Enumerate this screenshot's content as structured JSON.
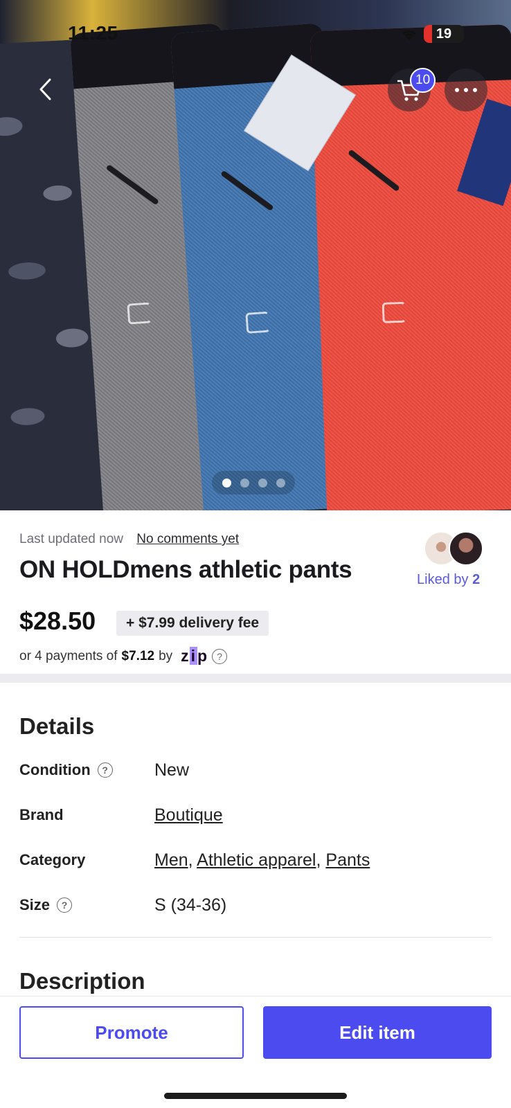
{
  "status_bar": {
    "time": "11:25",
    "battery": "19"
  },
  "header": {
    "cart_count": "10"
  },
  "gallery": {
    "image_count": 4,
    "active_index": 0
  },
  "listing": {
    "last_updated": "Last updated now",
    "comments_link": "No comments yet",
    "title": "ON HOLDmens athletic pants",
    "liked_prefix": "Liked by",
    "liked_count": "2",
    "price": "$28.50",
    "delivery_fee": "+ $7.99 delivery fee",
    "installments_prefix": "or 4 payments of",
    "installment_amount": "$7.12",
    "installments_by": "by",
    "zip_brand": "zip"
  },
  "details": {
    "heading": "Details",
    "condition_label": "Condition",
    "condition_value": "New",
    "brand_label": "Brand",
    "brand_value": "Boutique",
    "category_label": "Category",
    "category_values": [
      "Men",
      "Athletic apparel",
      "Pants"
    ],
    "size_label": "Size",
    "size_value": "S (34-36)"
  },
  "description": {
    "heading": "Description"
  },
  "actions": {
    "promote": "Promote",
    "edit": "Edit item"
  },
  "colors": {
    "accent": "#4b4bf0",
    "liked": "#5a5ae0",
    "chip_bg": "#ececf0"
  }
}
